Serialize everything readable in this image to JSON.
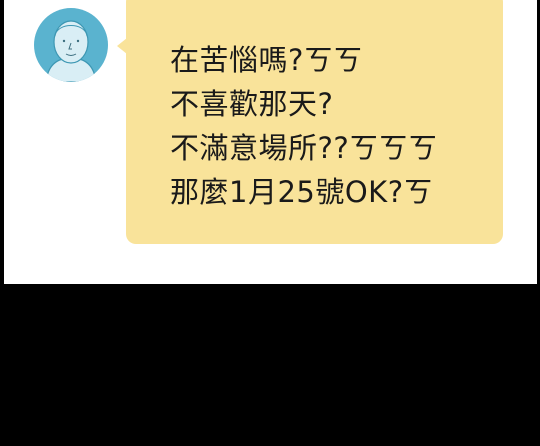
{
  "colors": {
    "background": "#000000",
    "panel": "#ffffff",
    "bubble": "#f9e39a",
    "avatar": "#5ab3cf",
    "text": "#1a1a1a"
  },
  "avatar": {
    "icon": "person-face-icon"
  },
  "message": {
    "lines": [
      "在苦惱嗎?ㄎㄎ",
      "不喜歡那天?",
      "不滿意場所??ㄎㄎㄎ",
      "那麼1月25號OK?ㄎ"
    ]
  }
}
